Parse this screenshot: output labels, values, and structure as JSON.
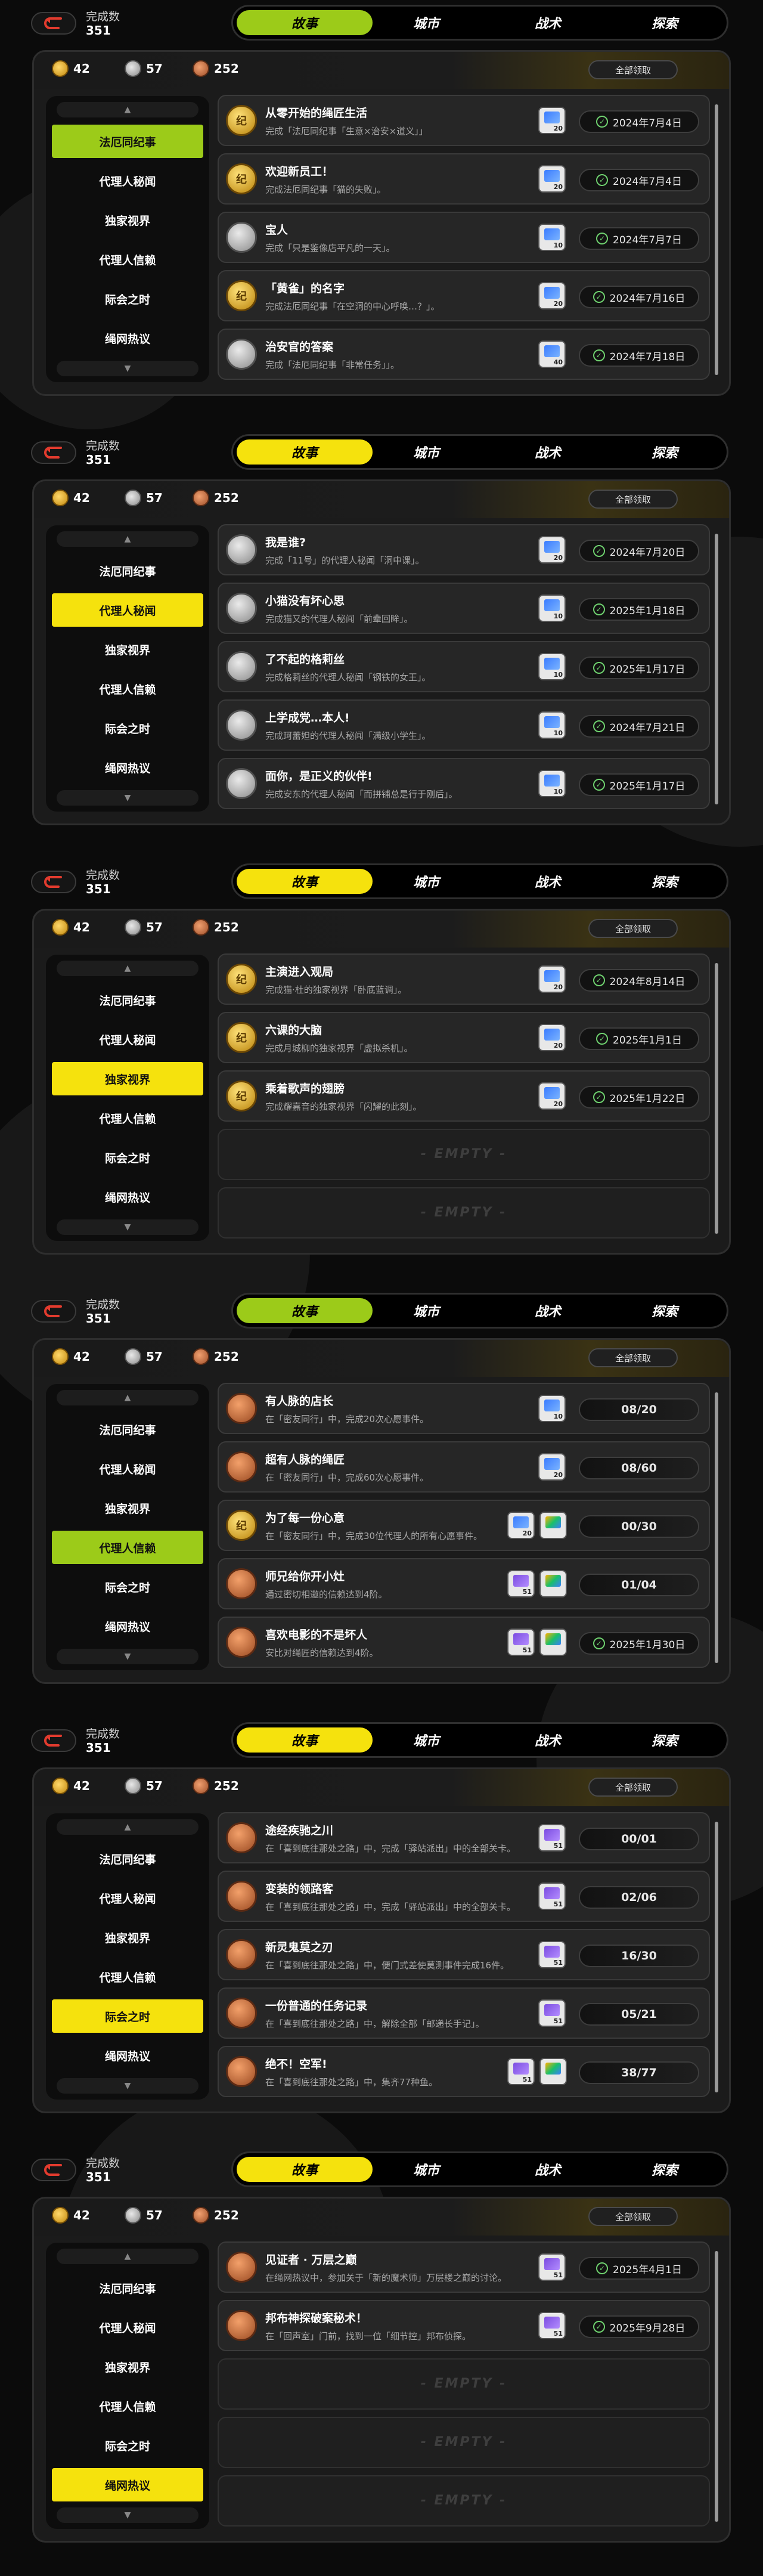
{
  "completion_label": "完成数",
  "completion_value": "351",
  "tabs": [
    "故事",
    "城市",
    "战术",
    "探索"
  ],
  "resources": [
    {
      "type": "gold",
      "value": "42"
    },
    {
      "type": "silver",
      "value": "57"
    },
    {
      "type": "bronze",
      "value": "252"
    }
  ],
  "claim_all": "全部领取",
  "scroll_up_icon": "chevron-up-icon",
  "scroll_down_icon": "chevron-down-icon",
  "side_menu": [
    "法厄同纪事",
    "代理人秘闻",
    "独家视界",
    "代理人信赖",
    "际会之时",
    "绳网热议"
  ],
  "empty_text": "- EMPTY -",
  "colors": {
    "accent_green": "#9ccb19",
    "accent_yellow": "#f5e20d"
  },
  "screens": [
    {
      "accent": "#9ccb19",
      "active_side": 0,
      "quests": [
        {
          "medal": "gold",
          "medal_text": "纪",
          "title": "从零开始的绳匠生活",
          "desc": "完成「法厄同纪事「生意×治安×道义」」",
          "rewards": [
            {
              "card": "blue",
              "num": "20"
            }
          ],
          "status": "2024年7月4日",
          "done": true
        },
        {
          "medal": "gold",
          "medal_text": "纪",
          "title": "欢迎新员工！",
          "desc": "完成法厄同纪事「猫的失败」。",
          "rewards": [
            {
              "card": "blue",
              "num": "20"
            }
          ],
          "status": "2024年7月4日",
          "done": true
        },
        {
          "medal": "silver",
          "medal_text": "",
          "title": "宝人",
          "desc": "完成「只是鉴像店平凡的一天」。",
          "rewards": [
            {
              "card": "blue",
              "num": "10"
            }
          ],
          "status": "2024年7月7日",
          "done": true
        },
        {
          "medal": "gold",
          "medal_text": "纪",
          "title": "「黄雀」的名字",
          "desc": "完成法厄同纪事「在空洞的中心呼唤…？」。",
          "rewards": [
            {
              "card": "blue",
              "num": "20"
            }
          ],
          "status": "2024年7月16日",
          "done": true
        },
        {
          "medal": "silver",
          "medal_text": "",
          "title": "治安官的答案",
          "desc": "完成「法厄同纪事「非常任务」」。",
          "rewards": [
            {
              "card": "blue",
              "num": "40"
            }
          ],
          "status": "2024年7月18日",
          "done": true
        }
      ]
    },
    {
      "accent": "#f5e20d",
      "active_side": 1,
      "quests": [
        {
          "medal": "silver",
          "medal_text": "",
          "title": "我是谁?",
          "desc": "完成「11号」的代理人秘闻「洞中课」。",
          "rewards": [
            {
              "card": "blue",
              "num": "20"
            }
          ],
          "status": "2024年7月20日",
          "done": true
        },
        {
          "medal": "silver",
          "medal_text": "",
          "title": "小猫没有坏心思",
          "desc": "完成猫又的代理人秘闻「前辈回眸」。",
          "rewards": [
            {
              "card": "blue",
              "num": "10"
            }
          ],
          "status": "2025年1月18日",
          "done": true
        },
        {
          "medal": "silver",
          "medal_text": "",
          "title": "了不起的格莉丝",
          "desc": "完成格莉丝的代理人秘闻「钢铁的女王」。",
          "rewards": [
            {
              "card": "blue",
              "num": "10"
            }
          ],
          "status": "2025年1月17日",
          "done": true
        },
        {
          "medal": "silver",
          "medal_text": "",
          "title": "上学成党…本人!",
          "desc": "完成珂蕾妲的代理人秘闻「满级小学生」。",
          "rewards": [
            {
              "card": "blue",
              "num": "10"
            }
          ],
          "status": "2024年7月21日",
          "done": true
        },
        {
          "medal": "silver",
          "medal_text": "",
          "title": "面你，是正义的伙伴!",
          "desc": "完成安东的代理人秘闻「而拼铺总是行于刚后」。",
          "rewards": [
            {
              "card": "blue",
              "num": "10"
            }
          ],
          "status": "2025年1月17日",
          "done": true
        }
      ]
    },
    {
      "accent": "#f5e20d",
      "active_side": 2,
      "quests": [
        {
          "medal": "gold",
          "medal_text": "纪",
          "title": "主演进入观局",
          "desc": "完成猫·杜的独家视界「卧底蓝调」。",
          "rewards": [
            {
              "card": "blue",
              "num": "20"
            }
          ],
          "status": "2024年8月14日",
          "done": true
        },
        {
          "medal": "gold",
          "medal_text": "纪",
          "title": "六课的大脑",
          "desc": "完成月城柳的独家视界「虚拟杀机」。",
          "rewards": [
            {
              "card": "blue",
              "num": "20"
            }
          ],
          "status": "2025年1月1日",
          "done": true
        },
        {
          "medal": "gold",
          "medal_text": "纪",
          "title": "乘着歌声的翅膀",
          "desc": "完成耀嘉音的独家视界「闪耀的此刻」。",
          "rewards": [
            {
              "card": "blue",
              "num": "20"
            }
          ],
          "status": "2025年1月22日",
          "done": true
        },
        {
          "empty": true
        },
        {
          "empty": true
        }
      ]
    },
    {
      "accent": "#9ccb19",
      "active_side": 3,
      "quests": [
        {
          "medal": "bronze",
          "medal_text": "",
          "title": "有人脉的店长",
          "desc": "在「密友同行」中，完成20次心愿事件。",
          "rewards": [
            {
              "card": "blue",
              "num": "10"
            }
          ],
          "status": "08/20",
          "done": false
        },
        {
          "medal": "bronze",
          "medal_text": "",
          "title": "超有人脉的绳匠",
          "desc": "在「密友同行」中，完成60次心愿事件。",
          "rewards": [
            {
              "card": "blue",
              "num": "20"
            }
          ],
          "status": "08/60",
          "done": false
        },
        {
          "medal": "gold",
          "medal_text": "纪",
          "title": "为了每一份心意",
          "desc": "在「密友同行」中，完成30位代理人的所有心愿事件。",
          "rewards": [
            {
              "card": "blue",
              "num": "20"
            },
            {
              "card": "multi",
              "num": ""
            }
          ],
          "status": "00/30",
          "done": false
        },
        {
          "medal": "bronze",
          "medal_text": "",
          "title": "师兄给你开小灶",
          "desc": "通过密切相邀的信赖达到4阶。",
          "rewards": [
            {
              "card": "purple",
              "num": "51"
            },
            {
              "card": "multi",
              "num": ""
            }
          ],
          "status": "01/04",
          "done": false
        },
        {
          "medal": "bronze",
          "medal_text": "",
          "title": "喜欢电影的不是坏人",
          "desc": "安比对绳匠的信赖达到4阶。",
          "rewards": [
            {
              "card": "purple",
              "num": "51"
            },
            {
              "card": "multi",
              "num": ""
            }
          ],
          "status": "2025年1月30日",
          "done": true
        }
      ]
    },
    {
      "accent": "#f5e20d",
      "active_side": 4,
      "quests": [
        {
          "medal": "bronze",
          "medal_text": "",
          "title": "途经疾驰之川",
          "desc": "在「喜到底往那处之路」中，完成「驿站派出」中的全部关卡。",
          "rewards": [
            {
              "card": "purple",
              "num": "51"
            }
          ],
          "status": "00/01",
          "done": false
        },
        {
          "medal": "bronze",
          "medal_text": "",
          "title": "变装的领路客",
          "desc": "在「喜到底往那处之路」中，完成「驿站派出」中的全部关卡。",
          "rewards": [
            {
              "card": "purple",
              "num": "51"
            }
          ],
          "status": "02/06",
          "done": false
        },
        {
          "medal": "bronze",
          "medal_text": "",
          "title": "新灵鬼莫之刃",
          "desc": "在「喜到底往那处之路」中，便门式差使莫测事件完成16件。",
          "rewards": [
            {
              "card": "purple",
              "num": "51"
            }
          ],
          "status": "16/30",
          "done": false
        },
        {
          "medal": "bronze",
          "medal_text": "",
          "title": "一份普通的任务记录",
          "desc": "在「喜到底往那处之路」中，解除全部「邮递长手记」。",
          "rewards": [
            {
              "card": "purple",
              "num": "51"
            }
          ],
          "status": "05/21",
          "done": false
        },
        {
          "medal": "bronze",
          "medal_text": "",
          "title": "绝不！空军!",
          "desc": "在「喜到底往那处之路」中，集齐77种鱼。",
          "rewards": [
            {
              "card": "purple",
              "num": "51"
            },
            {
              "card": "multi",
              "num": ""
            }
          ],
          "status": "38/77",
          "done": false
        }
      ]
    },
    {
      "accent": "#f5e20d",
      "active_side": 5,
      "quests": [
        {
          "medal": "bronze",
          "medal_text": "",
          "title": "见证者 · 万层之巅",
          "desc": "在绳网热议中，参加关于「新的魔术师」万层楼之巅的讨论。",
          "rewards": [
            {
              "card": "purple",
              "num": "51"
            }
          ],
          "status": "2025年4月1日",
          "done": true
        },
        {
          "medal": "bronze",
          "medal_text": "",
          "title": "邦布神探破案秘术！",
          "desc": "在「回声室」门前，找到一位「细节控」邦布侦探。",
          "rewards": [
            {
              "card": "purple",
              "num": "51"
            }
          ],
          "status": "2025年9月28日",
          "done": true
        },
        {
          "empty": true
        },
        {
          "empty": true
        },
        {
          "empty": true
        }
      ]
    }
  ]
}
